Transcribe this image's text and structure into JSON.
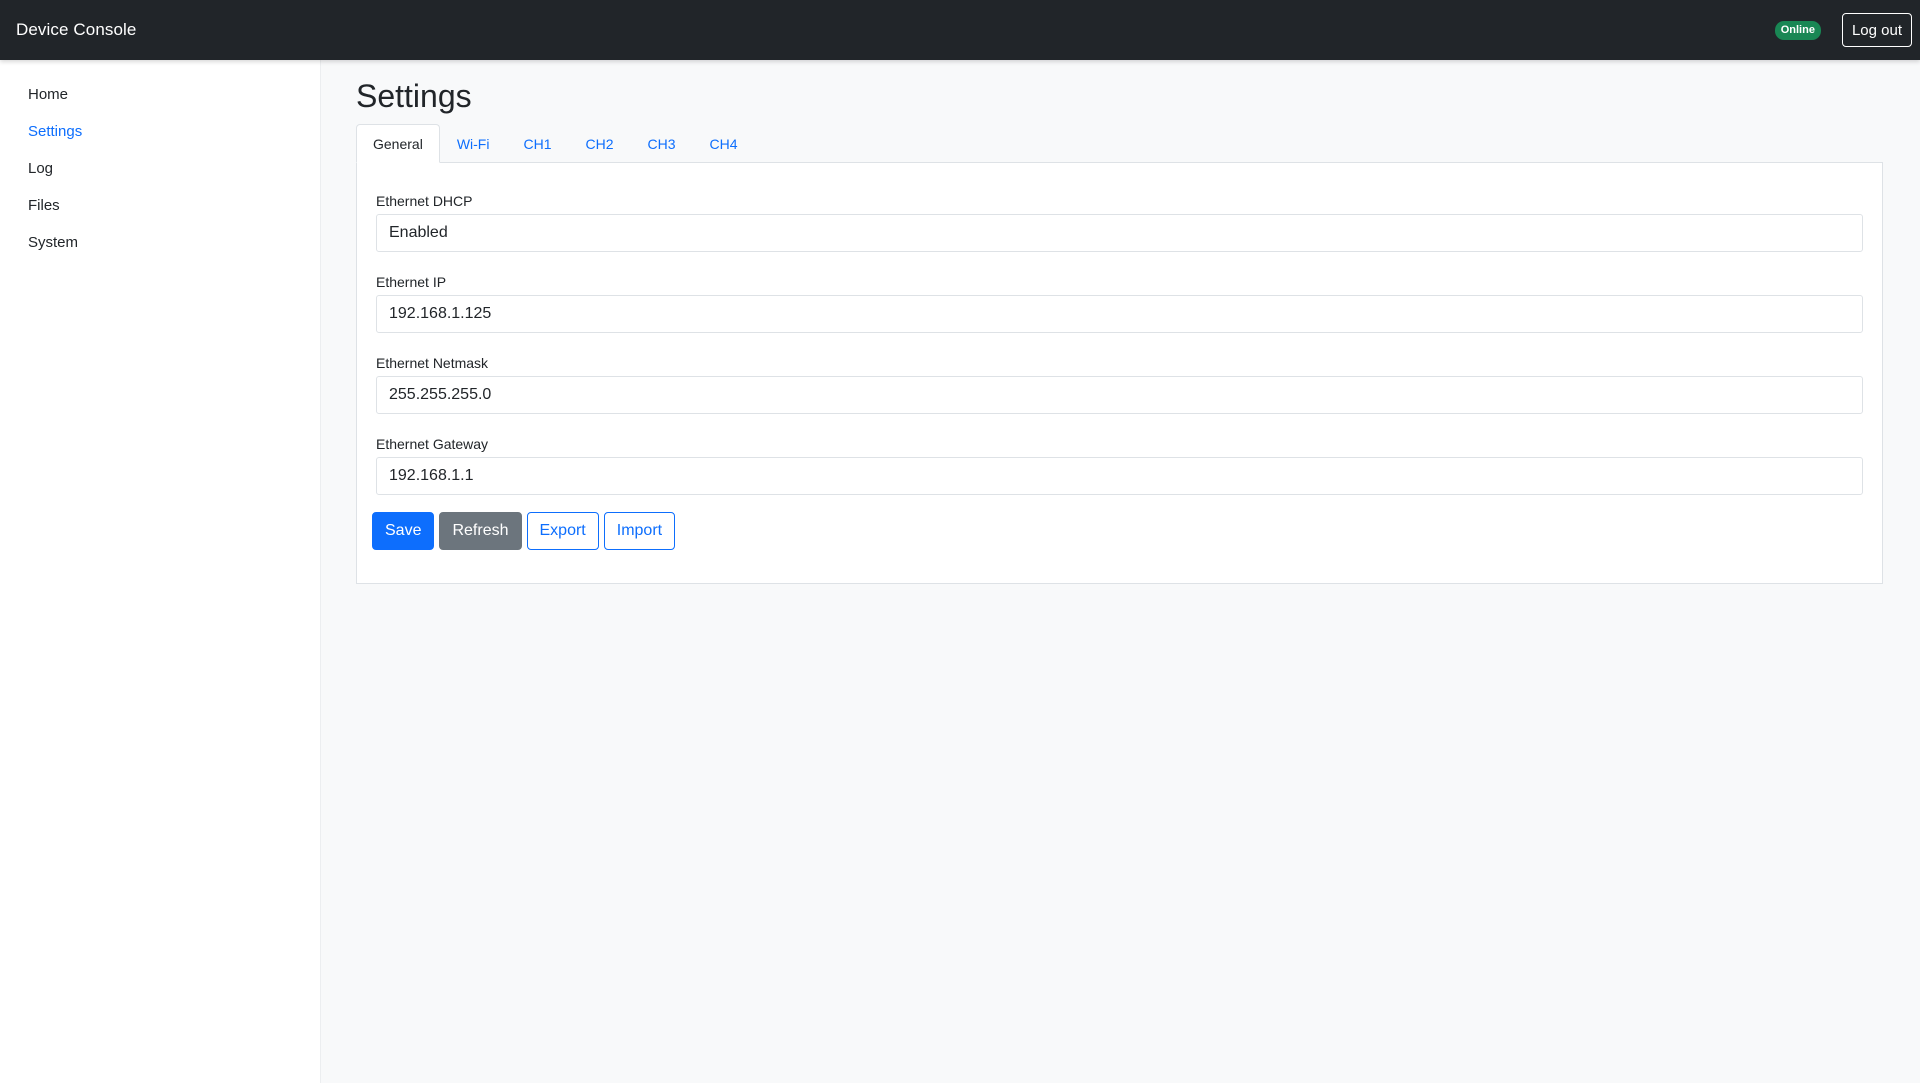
{
  "header": {
    "brand": "Device Console",
    "status": "Online",
    "logout_label": "Log out"
  },
  "sidebar": {
    "items": [
      {
        "label": "Home"
      },
      {
        "label": "Settings"
      },
      {
        "label": "Log"
      },
      {
        "label": "Files"
      },
      {
        "label": "System"
      }
    ]
  },
  "main": {
    "title": "Settings",
    "tabs": [
      {
        "label": "General"
      },
      {
        "label": "Wi-Fi"
      },
      {
        "label": "CH1"
      },
      {
        "label": "CH2"
      },
      {
        "label": "CH3"
      },
      {
        "label": "CH4"
      }
    ],
    "fields": [
      {
        "label": "Ethernet DHCP",
        "value": "Enabled"
      },
      {
        "label": "Ethernet IP",
        "value": "192.168.1.125"
      },
      {
        "label": "Ethernet Netmask",
        "value": "255.255.255.0"
      },
      {
        "label": "Ethernet Gateway",
        "value": "192.168.1.1"
      }
    ],
    "actions": {
      "save": "Save",
      "refresh": "Refresh",
      "export": "Export",
      "import": "Import"
    }
  },
  "colors": {
    "header_bg": "#212529",
    "accent": "#0d6efd",
    "status_online": "#198754",
    "secondary": "#6c757d"
  }
}
